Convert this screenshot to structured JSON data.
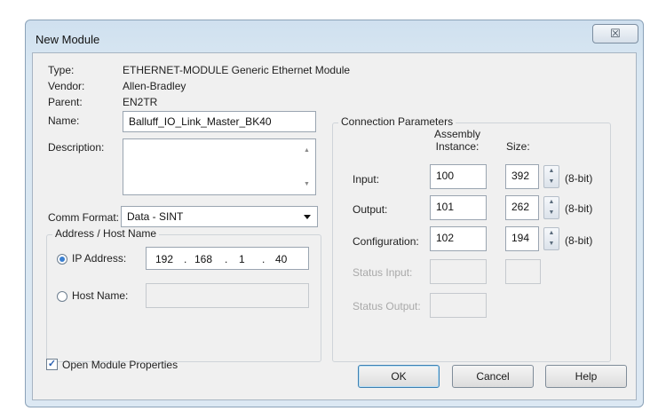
{
  "window": {
    "title": "New Module",
    "close_glyph": "☒"
  },
  "info": {
    "type_label": "Type:",
    "type_value": "ETHERNET-MODULE Generic Ethernet Module",
    "vendor_label": "Vendor:",
    "vendor_value": "Allen-Bradley",
    "parent_label": "Parent:",
    "parent_value": "EN2TR"
  },
  "name": {
    "label": "Name:",
    "value": "Balluff_IO_Link_Master_BK40"
  },
  "description": {
    "label": "Description:",
    "value": ""
  },
  "comm_format": {
    "label": "Comm Format:",
    "value": "Data - SINT"
  },
  "address": {
    "group_title": "Address / Host Name",
    "ip_label": "IP Address:",
    "ip_octets": [
      "192",
      "168",
      "1",
      "40"
    ],
    "ip_selected": true,
    "host_label": "Host Name:",
    "host_value": ""
  },
  "connection": {
    "group_title": "Connection Parameters",
    "col_instance": "Assembly\nInstance:",
    "col_instance_l1": "Assembly",
    "col_instance_l2": "Instance:",
    "col_size": "Size:",
    "rows": [
      {
        "label": "Input:",
        "instance": "100",
        "size": "392",
        "unit": "(8-bit)"
      },
      {
        "label": "Output:",
        "instance": "101",
        "size": "262",
        "unit": "(8-bit)"
      },
      {
        "label": "Configuration:",
        "instance": "102",
        "size": "194",
        "unit": "(8-bit)"
      }
    ],
    "status_input_label": "Status Input:",
    "status_output_label": "Status Output:"
  },
  "footer": {
    "open_props_label": "Open Module Properties",
    "open_props_checked": true,
    "ok": "OK",
    "cancel": "Cancel",
    "help": "Help"
  },
  "colors": {
    "titlebar": "#d5e4f1",
    "client": "#f0f0f0",
    "radio_on": "#3a7fd0",
    "default_button_border": "#3c7fb1"
  }
}
